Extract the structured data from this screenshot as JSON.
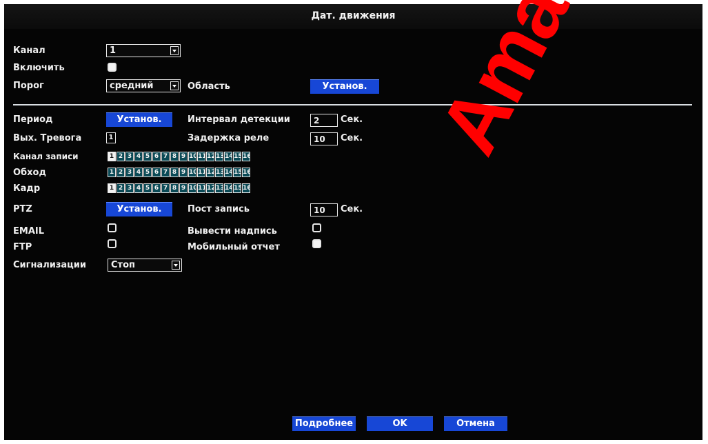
{
  "title": "Дат. движения",
  "labels": {
    "channel": "Канал",
    "enable": "Включить",
    "threshold": "Порог",
    "area": "Область",
    "period": "Период",
    "detect_interval": "Интервал детекции",
    "alarm_out": "Вых. Тревога",
    "relay_delay": "Задержка реле",
    "record_channel": "Канал записи",
    "tour": "Обход",
    "snapshot": "Кадр",
    "ptz": "PTZ",
    "post_record": "Пост запись",
    "email": "EMAIL",
    "show_message": "Вывести надпись",
    "ftp": "FTP",
    "mobile_report": "Мобильный отчет",
    "buzzer": "Сигнализации"
  },
  "values": {
    "channel": "1",
    "threshold": "средний",
    "detect_interval": "2",
    "relay_delay": "10",
    "post_record": "10",
    "buzzer": "Стоп",
    "alarm_out_channel": "1"
  },
  "units": {
    "sec": "Сек."
  },
  "buttons": {
    "set": "Установ.",
    "advanced": "Подробнее",
    "ok": "OK",
    "cancel": "Отмена"
  },
  "checkboxes": {
    "enable": true,
    "email": false,
    "show_message": false,
    "ftp": false,
    "mobile_report": true
  },
  "channel_grids": {
    "record_channel": {
      "numbers": [
        "1",
        "2",
        "3",
        "4",
        "5",
        "6",
        "7",
        "8",
        "9",
        "10",
        "11",
        "12",
        "13",
        "14",
        "15",
        "16"
      ],
      "selected": [
        "1"
      ]
    },
    "tour": {
      "numbers": [
        "1",
        "2",
        "3",
        "4",
        "5",
        "6",
        "7",
        "8",
        "9",
        "10",
        "11",
        "12",
        "13",
        "14",
        "15",
        "16"
      ],
      "selected": []
    },
    "snapshot": {
      "numbers": [
        "1",
        "2",
        "3",
        "4",
        "5",
        "6",
        "7",
        "8",
        "9",
        "10",
        "11",
        "12",
        "13",
        "14",
        "15",
        "16"
      ],
      "selected": [
        "1"
      ]
    }
  },
  "watermark": "Amatek",
  "colors": {
    "background": "#050505",
    "button": "#1747d6",
    "channel_cell": "#0b4a56",
    "watermark": "#ff0000"
  }
}
